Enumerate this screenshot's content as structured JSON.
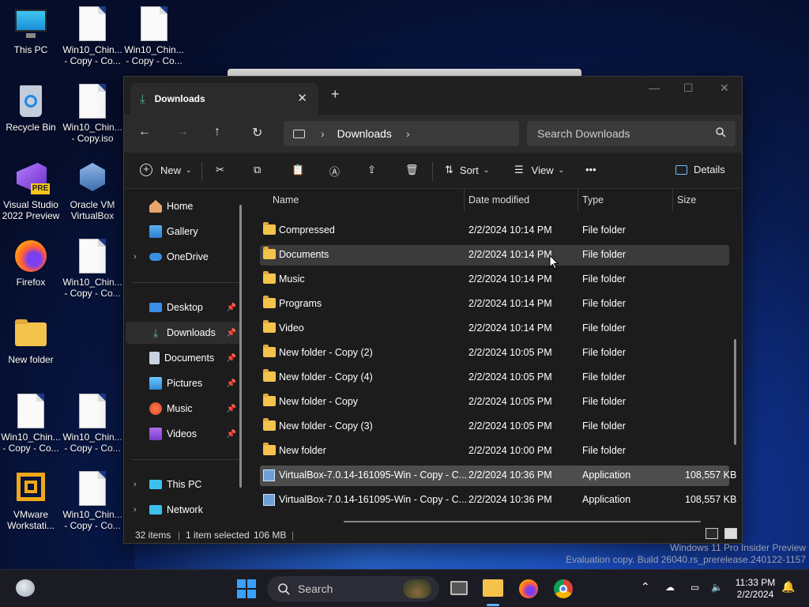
{
  "desktop": {
    "icons": [
      {
        "label": "This PC"
      },
      {
        "label": "Win10_Chin... - Copy - Co..."
      },
      {
        "label": "Win10_Chin... - Copy - Co..."
      },
      {
        "label": "Recycle Bin"
      },
      {
        "label": "Win10_Chin... - Copy.iso"
      },
      {
        "label": "Visual Studio 2022 Preview"
      },
      {
        "label": "Oracle VM VirtualBox"
      },
      {
        "label": "Firefox"
      },
      {
        "label": "Win10_Chin... - Copy - Co..."
      },
      {
        "label": "New folder"
      },
      {
        "label": "Win10_Chin... - Copy - Co..."
      },
      {
        "label": "Win10_Chin... - Copy - Co..."
      },
      {
        "label": "VMware Workstati..."
      },
      {
        "label": "Win10_Chin... - Copy - Co..."
      }
    ],
    "vs_badge": "PRE"
  },
  "explorer": {
    "tab_title": "Downloads",
    "breadcrumb_current": "Downloads",
    "search_placeholder": "Search Downloads",
    "toolbar": {
      "new_label": "New",
      "sort_label": "Sort",
      "view_label": "View",
      "more_label": "•••",
      "details_label": "Details"
    },
    "sidebar": {
      "top": [
        {
          "label": "Home"
        },
        {
          "label": "Gallery"
        },
        {
          "label": "OneDrive"
        }
      ],
      "quick": [
        {
          "label": "Desktop"
        },
        {
          "label": "Downloads"
        },
        {
          "label": "Documents"
        },
        {
          "label": "Pictures"
        },
        {
          "label": "Music"
        },
        {
          "label": "Videos"
        }
      ],
      "bottom": [
        {
          "label": "This PC"
        },
        {
          "label": "Network"
        }
      ]
    },
    "columns": {
      "name": "Name",
      "date": "Date modified",
      "type": "Type",
      "size": "Size"
    },
    "rows": [
      {
        "name": "Compressed",
        "date": "2/2/2024 10:14 PM",
        "type": "File folder",
        "size": ""
      },
      {
        "name": "Documents",
        "date": "2/2/2024 10:14 PM",
        "type": "File folder",
        "size": ""
      },
      {
        "name": "Music",
        "date": "2/2/2024 10:14 PM",
        "type": "File folder",
        "size": ""
      },
      {
        "name": "Programs",
        "date": "2/2/2024 10:14 PM",
        "type": "File folder",
        "size": ""
      },
      {
        "name": "Video",
        "date": "2/2/2024 10:14 PM",
        "type": "File folder",
        "size": ""
      },
      {
        "name": "New folder - Copy (2)",
        "date": "2/2/2024 10:05 PM",
        "type": "File folder",
        "size": ""
      },
      {
        "name": "New folder - Copy (4)",
        "date": "2/2/2024 10:05 PM",
        "type": "File folder",
        "size": ""
      },
      {
        "name": "New folder - Copy",
        "date": "2/2/2024 10:05 PM",
        "type": "File folder",
        "size": ""
      },
      {
        "name": "New folder - Copy (3)",
        "date": "2/2/2024 10:05 PM",
        "type": "File folder",
        "size": ""
      },
      {
        "name": "New folder",
        "date": "2/2/2024 10:00 PM",
        "type": "File folder",
        "size": ""
      },
      {
        "name": "VirtualBox-7.0.14-161095-Win - Copy - C...",
        "date": "2/2/2024 10:36 PM",
        "type": "Application",
        "size": "108,557 KB"
      },
      {
        "name": "VirtualBox-7.0.14-161095-Win - Copy - C...",
        "date": "2/2/2024 10:36 PM",
        "type": "Application",
        "size": "108,557 KB"
      }
    ],
    "status": {
      "items": "32 items",
      "selected": "1 item selected",
      "size": "106 MB"
    }
  },
  "watermark": {
    "line1": "Windows 11 Pro Insider Preview",
    "line2": "Evaluation copy. Build 26040.rs_prerelease.240122-1157"
  },
  "taskbar": {
    "search_label": "Search",
    "time": "11:33 PM",
    "date": "2/2/2024"
  }
}
